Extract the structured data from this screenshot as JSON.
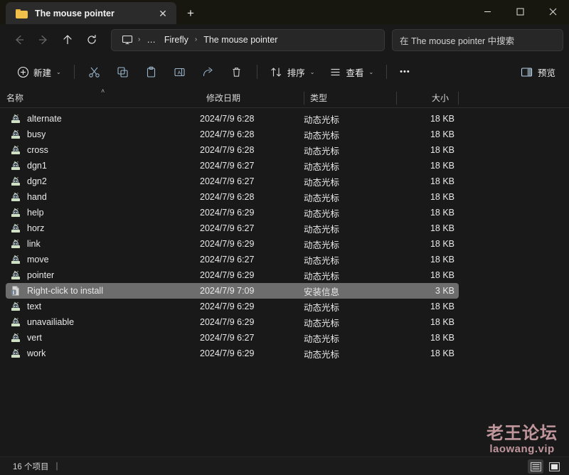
{
  "window": {
    "tab_title": "The mouse pointer",
    "tab_close_label": "✕",
    "new_tab_label": "+",
    "minimize_label": "minimize",
    "maximize_label": "maximize",
    "close_label": "close"
  },
  "nav": {
    "back_label": "back",
    "forward_label": "forward",
    "up_label": "up",
    "refresh_label": "refresh"
  },
  "breadcrumb": {
    "root_icon": "monitor-icon",
    "overflow_label": "…",
    "items": [
      {
        "label": "Firefly"
      },
      {
        "label": "The mouse pointer"
      }
    ],
    "separator": "›"
  },
  "search": {
    "placeholder": "在 The mouse pointer 中搜索"
  },
  "commandbar": {
    "new_label": "新建",
    "cut_label": "剪切",
    "copy_label": "复制",
    "paste_label": "粘贴",
    "rename_label": "重命名",
    "share_label": "共享",
    "delete_label": "删除",
    "sort_label": "排序",
    "view_label": "查看",
    "more_label": "•••",
    "preview_label": "预览",
    "chevron": "⌄"
  },
  "columns": {
    "name": "名称",
    "date": "修改日期",
    "type": "类型",
    "size": "大小",
    "sort_indicator": "˄"
  },
  "files": [
    {
      "name": "alternate",
      "date": "2024/7/9 6:28",
      "type": "动态光标",
      "size": "18 KB",
      "icon": "cursor-icon",
      "selected": false
    },
    {
      "name": "busy",
      "date": "2024/7/9 6:28",
      "type": "动态光标",
      "size": "18 KB",
      "icon": "cursor-icon",
      "selected": false
    },
    {
      "name": "cross",
      "date": "2024/7/9 6:28",
      "type": "动态光标",
      "size": "18 KB",
      "icon": "cursor-icon",
      "selected": false
    },
    {
      "name": "dgn1",
      "date": "2024/7/9 6:27",
      "type": "动态光标",
      "size": "18 KB",
      "icon": "cursor-icon",
      "selected": false
    },
    {
      "name": "dgn2",
      "date": "2024/7/9 6:27",
      "type": "动态光标",
      "size": "18 KB",
      "icon": "cursor-icon",
      "selected": false
    },
    {
      "name": "hand",
      "date": "2024/7/9 6:28",
      "type": "动态光标",
      "size": "18 KB",
      "icon": "cursor-icon",
      "selected": false
    },
    {
      "name": "help",
      "date": "2024/7/9 6:29",
      "type": "动态光标",
      "size": "18 KB",
      "icon": "cursor-icon",
      "selected": false
    },
    {
      "name": "horz",
      "date": "2024/7/9 6:27",
      "type": "动态光标",
      "size": "18 KB",
      "icon": "cursor-icon",
      "selected": false
    },
    {
      "name": "link",
      "date": "2024/7/9 6:29",
      "type": "动态光标",
      "size": "18 KB",
      "icon": "cursor-icon",
      "selected": false
    },
    {
      "name": "move",
      "date": "2024/7/9 6:27",
      "type": "动态光标",
      "size": "18 KB",
      "icon": "cursor-icon",
      "selected": false
    },
    {
      "name": "pointer",
      "date": "2024/7/9 6:29",
      "type": "动态光标",
      "size": "18 KB",
      "icon": "cursor-icon",
      "selected": false
    },
    {
      "name": "Right-click to install",
      "date": "2024/7/9 7:09",
      "type": "安装信息",
      "size": "3 KB",
      "icon": "inf-file-icon",
      "selected": true
    },
    {
      "name": "text",
      "date": "2024/7/9 6:29",
      "type": "动态光标",
      "size": "18 KB",
      "icon": "cursor-icon",
      "selected": false
    },
    {
      "name": "unavailiable",
      "date": "2024/7/9 6:29",
      "type": "动态光标",
      "size": "18 KB",
      "icon": "cursor-icon",
      "selected": false
    },
    {
      "name": "vert",
      "date": "2024/7/9 6:27",
      "type": "动态光标",
      "size": "18 KB",
      "icon": "cursor-icon",
      "selected": false
    },
    {
      "name": "work",
      "date": "2024/7/9 6:29",
      "type": "动态光标",
      "size": "18 KB",
      "icon": "cursor-icon",
      "selected": false
    }
  ],
  "statusbar": {
    "item_count": "16 个项目",
    "separator": "|",
    "details_view_label": "details-view",
    "large_icons_view_label": "large-icons-view"
  },
  "watermark": {
    "cn": "老王论坛",
    "en": "laowang.vip"
  },
  "colors": {
    "window_bg": "#191919",
    "titlebar_bg": "#17160f",
    "tab_bg": "#2b2b2b",
    "field_bg": "#272727",
    "selection_bg": "#6d6d6d",
    "folder_icon": "#f0c04a",
    "accent_icon": "#9bb6cc",
    "watermark": "#d8a8b0"
  }
}
